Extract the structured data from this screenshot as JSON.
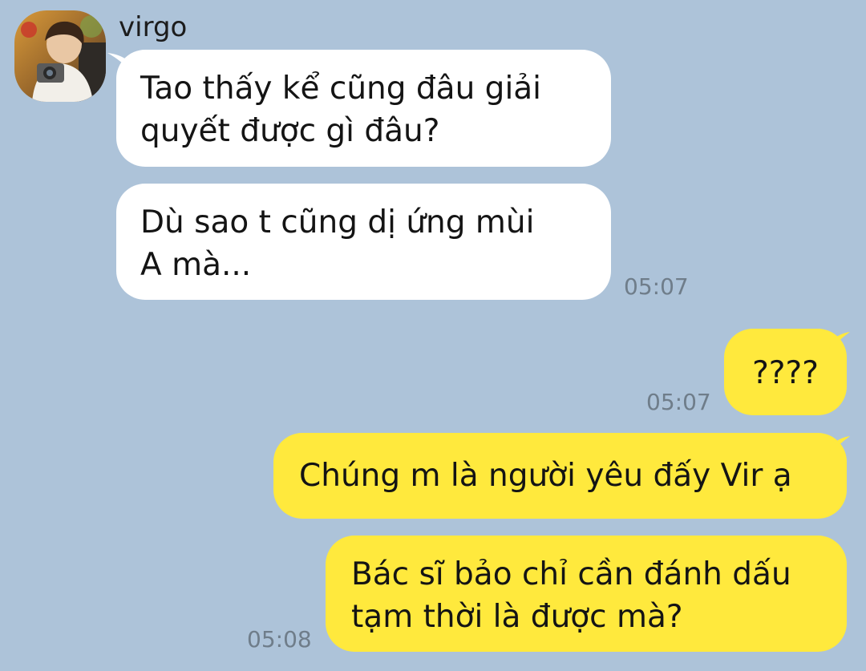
{
  "contact": {
    "name": "virgo",
    "avatar": "avatar-photo"
  },
  "messages": [
    {
      "direction": "in",
      "text_line1": "Tao thấy kể cũng đâu giải",
      "text_line2": "quyết được gì đâu?"
    },
    {
      "direction": "in",
      "text_line1": "Dù sao t cũng dị ứng mùi",
      "text_line2": "A mà...",
      "time": "05:07"
    },
    {
      "direction": "out",
      "text": "????",
      "time": "05:07"
    },
    {
      "direction": "out",
      "text": "Chúng m là người yêu đấy Vir ạ"
    },
    {
      "direction": "out",
      "text_line1": "Bác sĩ bảo chỉ cần đánh dấu",
      "text_line2": "tạm thời là được mà?",
      "time": "05:08"
    }
  ],
  "colors": {
    "background": "#adc3d9",
    "incoming_bubble": "#ffffff",
    "outgoing_bubble": "#ffe93d",
    "timestamp": "#6f7d8a"
  }
}
